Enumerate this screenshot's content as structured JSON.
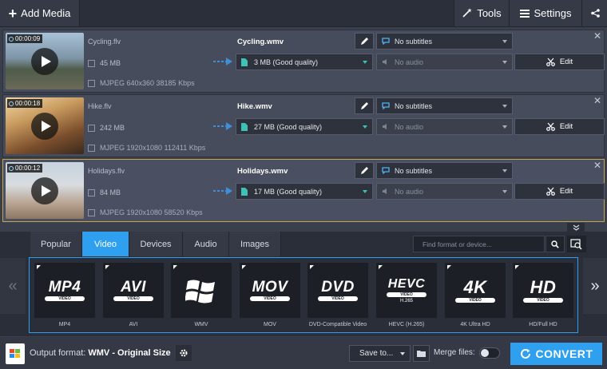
{
  "toolbar": {
    "add_media_label": "Add Media",
    "tools_label": "Tools",
    "settings_label": "Settings"
  },
  "files": [
    {
      "duration": "00:00:09",
      "source_name": "Cycling.flv",
      "source_size": "45 MB",
      "source_codec": "MJPEG 640x360 38185 Kbps",
      "output_name": "Cycling.wmv",
      "output_quality": "3 MB (Good quality)",
      "subtitles": "No subtitles",
      "audio": "No audio",
      "edit_label": "Edit",
      "selected": false
    },
    {
      "duration": "00:00:18",
      "source_name": "Hike.flv",
      "source_size": "242 MB",
      "source_codec": "MJPEG 1920x1080 112411 Kbps",
      "output_name": "Hike.wmv",
      "output_quality": "27 MB (Good quality)",
      "subtitles": "No subtitles",
      "audio": "No audio",
      "edit_label": "Edit",
      "selected": false
    },
    {
      "duration": "00:00:12",
      "source_name": "Holidays.flv",
      "source_size": "84 MB",
      "source_codec": "MJPEG 1920x1080 58520 Kbps",
      "output_name": "Holidays.wmv",
      "output_quality": "17 MB (Good quality)",
      "subtitles": "No subtitles",
      "audio": "No audio",
      "edit_label": "Edit",
      "selected": true
    }
  ],
  "format_tabs": [
    "Popular",
    "Video",
    "Devices",
    "Audio",
    "Images"
  ],
  "active_tab": "Video",
  "search": {
    "placeholder": "Find format or device..."
  },
  "formats": [
    {
      "badge": "MP4",
      "pill": "VIDEO",
      "sub": "",
      "label": "MP4"
    },
    {
      "badge": "AVI",
      "pill": "VIDEO",
      "sub": "",
      "label": "AVI"
    },
    {
      "badge": "",
      "pill": "",
      "sub": "",
      "label": "WMV",
      "icon": "windows-logo-icon"
    },
    {
      "badge": "MOV",
      "pill": "VIDEO",
      "sub": "",
      "label": "MOV"
    },
    {
      "badge": "DVD",
      "pill": "VIDEO",
      "sub": "",
      "label": "DVD-Compatible Video"
    },
    {
      "badge": "HEVC",
      "pill": "VIDEO",
      "sub": "H.265",
      "label": "HEVC (H.265)"
    },
    {
      "badge": "4K",
      "pill": "VIDEO",
      "sub": "",
      "label": "4K Ultra HD"
    },
    {
      "badge": "HD",
      "pill": "VIDEO",
      "sub": "",
      "label": "HD/Full HD"
    }
  ],
  "bottom": {
    "output_prefix": "Output format:",
    "output_value": "WMV - Original Size",
    "save_to_label": "Save to...",
    "merge_label": "Merge files:",
    "convert_label": "CONVERT"
  },
  "colors": {
    "accent": "#2fa0ef",
    "selected_border": "#c8a44a",
    "quality_accent": "#3fc1b6"
  }
}
